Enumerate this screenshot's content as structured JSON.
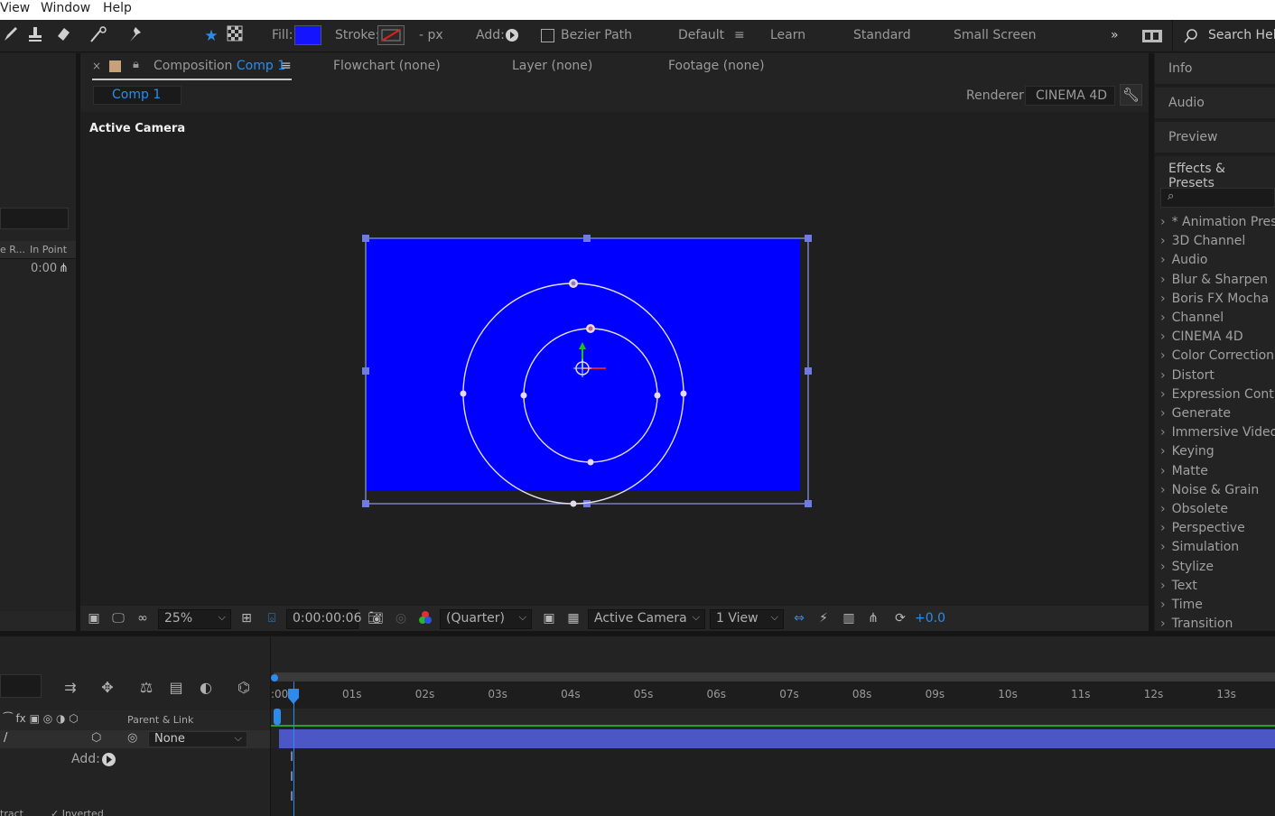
{
  "menu": {
    "items": [
      "View",
      "Window",
      "Help"
    ]
  },
  "toolbar": {
    "fill_label": "Fill:",
    "stroke_label": "Stroke:",
    "stroke_width": "- px",
    "add_label": "Add:",
    "bezier_label": "Bezier Path",
    "workspaces": [
      "Default",
      "Learn",
      "Standard",
      "Small Screen"
    ],
    "search_label": "Search Help",
    "fill_color": "#1414ff"
  },
  "tabs": {
    "composition_prefix": "Composition",
    "composition_name": "Comp 1",
    "flowchart": "Flowchart  (none)",
    "layer": "Layer  (none)",
    "footage": "Footage  (none)"
  },
  "viewer": {
    "comp_chip": "Comp 1",
    "renderer_label": "Renderer:",
    "renderer_value": "CINEMA 4D",
    "camera_label": "Active Camera",
    "comp_color": "#0000ff"
  },
  "viewer_bar": {
    "zoom": "25%",
    "timecode": "0:00:00:06",
    "resolution": "(Quarter)",
    "camera": "Active Camera",
    "views": "1 View",
    "exposure": "+0.0"
  },
  "left_panel": {
    "col_in_point": "In Point",
    "col_stretch": "e R...",
    "time_value": "0:00"
  },
  "right_panel": {
    "buttons": [
      "Info",
      "Audio",
      "Preview"
    ],
    "effects_title": "Effects & Presets",
    "search_placeholder": "",
    "effects": [
      "* Animation Prese",
      "3D Channel",
      "Audio",
      "Blur & Sharpen",
      "Boris FX Mocha",
      "Channel",
      "CINEMA 4D",
      "Color Correction",
      "Distort",
      "Expression Contro",
      "Generate",
      "Immersive Video",
      "Keying",
      "Matte",
      "Noise & Grain",
      "Obsolete",
      "Perspective",
      "Simulation",
      "Stylize",
      "Text",
      "Time",
      "Transition"
    ]
  },
  "timeline": {
    "ruler_labels": [
      ":00",
      "01s",
      "02s",
      "03s",
      "04s",
      "05s",
      "06s",
      "07s",
      "08s",
      "09s",
      "10s",
      "11s",
      "12s",
      "13s"
    ],
    "parent_link_label": "Parent & Link",
    "parent_value": "None",
    "add_label": "Add:",
    "extract_label": "tract",
    "inverted_label": "Inverted"
  }
}
